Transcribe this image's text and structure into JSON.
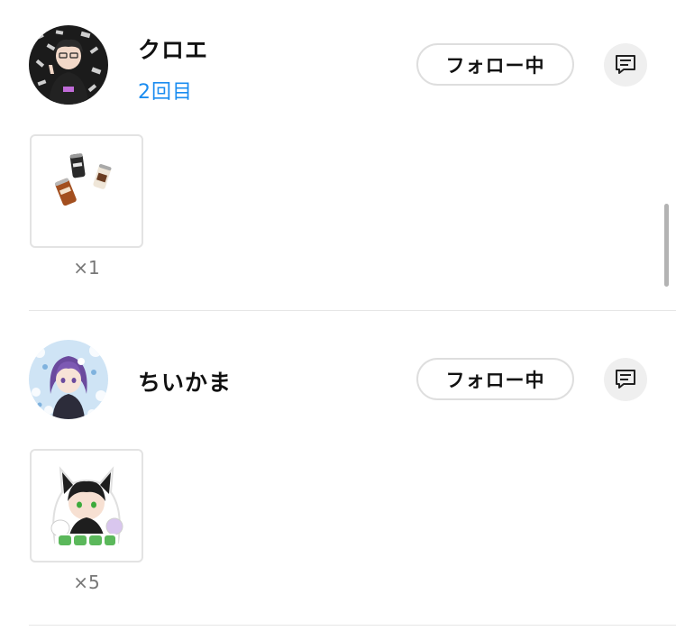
{
  "supporters": [
    {
      "username": "クロエ",
      "visit_count": "2回目",
      "follow_label": "フォロー中",
      "avatar_icon": "avatar-dark-character-icon",
      "gift": {
        "icon": "drink-cans-icon",
        "quantity": "×1"
      }
    },
    {
      "username": "ちいかま",
      "visit_count": "",
      "follow_label": "フォロー中",
      "avatar_icon": "avatar-purple-hair-character-icon",
      "gift": {
        "icon": "teete-sticker-icon",
        "quantity": "×5"
      }
    }
  ],
  "icons": {
    "message": "message-icon"
  },
  "colors": {
    "accent": "#1a8cf0",
    "button_border": "#dedede",
    "message_bg": "#efefef"
  }
}
